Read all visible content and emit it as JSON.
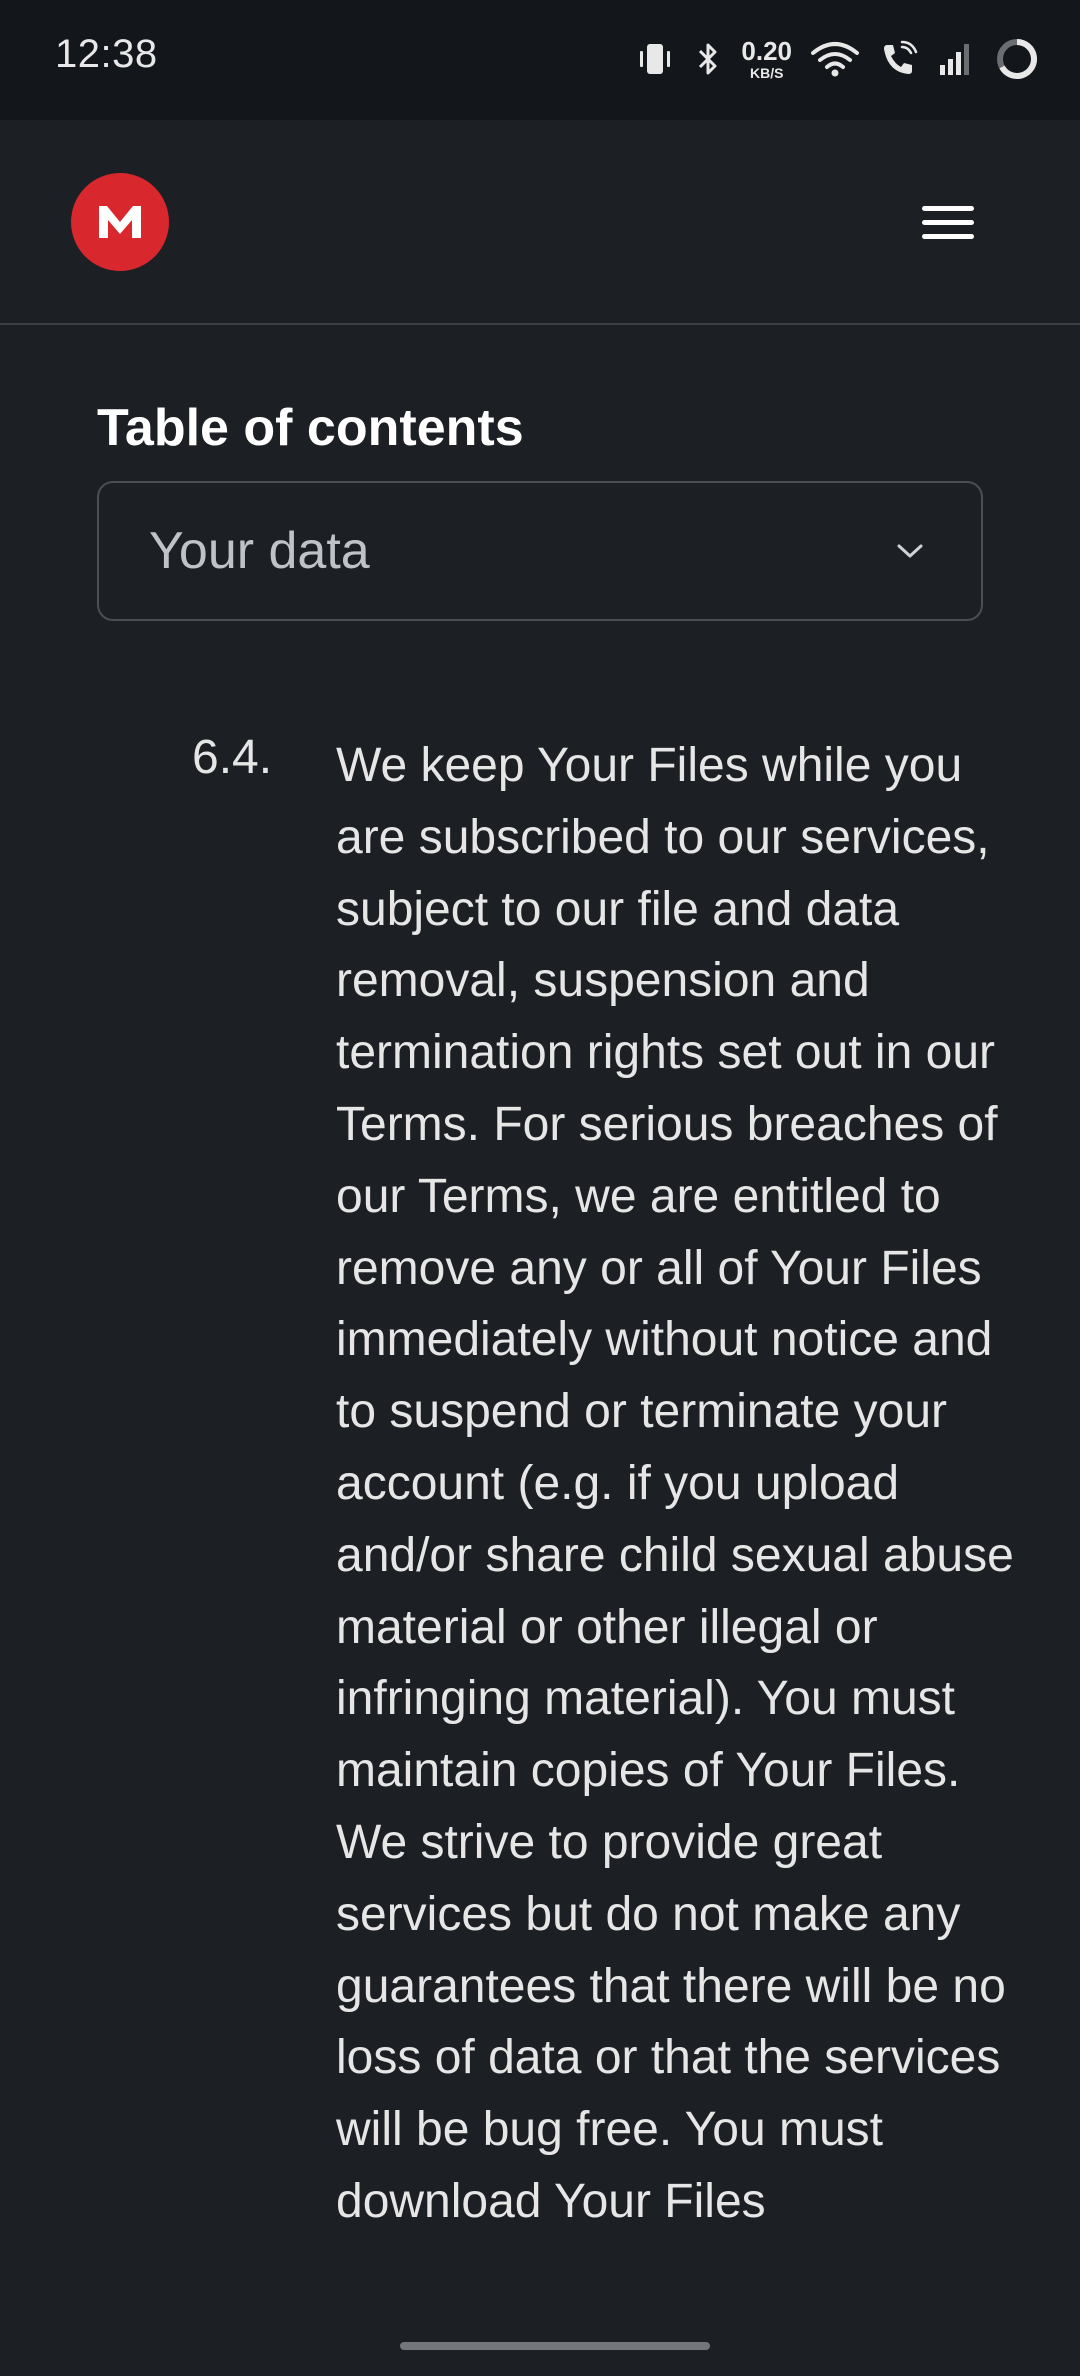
{
  "status_bar": {
    "time": "12:38",
    "net_speed_value": "0.20",
    "net_speed_unit": "KB/S",
    "icons": [
      "vibrate-icon",
      "bluetooth-icon",
      "wifi-icon",
      "wifi-calling-icon",
      "signal-icon",
      "battery-ring-icon"
    ]
  },
  "header": {
    "logo_letter": "M",
    "logo_color": "#d9272e",
    "menu_icon": "hamburger-menu-icon"
  },
  "toc": {
    "heading": "Table of contents",
    "selected": "Your data",
    "chevron_icon": "chevron-down-icon"
  },
  "clause": {
    "number": "6.4.",
    "text": "We keep Your Files while you are subscribed to our services, subject to our file and data removal, suspension and termination rights set out in our Terms. For serious breaches of our Terms, we are entitled to remove any or all of Your Files immediately without notice and to suspend or terminate your account (e.g. if you upload and/or share child sexual abuse material or other illegal or infringing material). You must maintain copies of Your Files. We strive to provide great services but do not make any guarantees that there will be no loss of data or that the services will be bug free. You must download Your Files"
  }
}
